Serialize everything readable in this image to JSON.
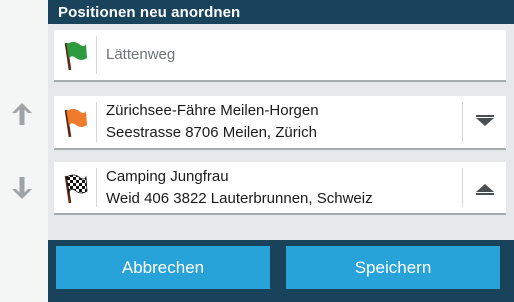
{
  "title": "Positionen neu anordnen",
  "rail": {
    "up_icon": "arrow-up-icon",
    "down_icon": "arrow-down-icon"
  },
  "stops": [
    {
      "flag_icon": "green-flag-icon",
      "flag_color": "#2e9a3e",
      "line1": "Lättenweg",
      "line2": "",
      "is_placeholder": true
    },
    {
      "flag_icon": "orange-flag-icon",
      "flag_color": "#ef7a2a",
      "line1": "Zürichsee-Fähre Meilen-Horgen",
      "line2": "Seestrasse 8706 Meilen, Zürich",
      "move_icon": "move-down-icon"
    },
    {
      "flag_icon": "checkered-flag-icon",
      "line1": "Camping Jungfrau",
      "line2": "Weid 406 3822 Lauterbrunnen, Schweiz",
      "move_icon": "move-up-icon"
    }
  ],
  "buttons": {
    "cancel": "Abbrechen",
    "save": "Speichern"
  },
  "colors": {
    "panel": "#19425b",
    "button": "#28a3da",
    "list_bg": "#e6e8e9"
  }
}
